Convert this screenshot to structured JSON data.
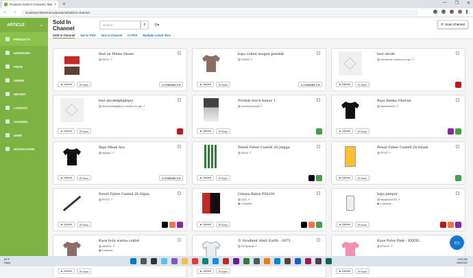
{
  "browser": {
    "tab_title": "Products Sold In Channel | Manu...",
    "url": "localhost:3001/menu/products/sold-in-channel"
  },
  "sidebar": {
    "brand": "ARTICLE",
    "items": [
      {
        "label": "PRODUCTS",
        "active": true
      },
      {
        "label": "INVENTORY"
      },
      {
        "label": "PRICE"
      },
      {
        "label": "ORDER"
      },
      {
        "label": "REPORT"
      },
      {
        "label": "LOGISTIC"
      },
      {
        "label": "CHANNEL"
      },
      {
        "label": "USER"
      },
      {
        "label": "NOTIFICATION"
      }
    ]
  },
  "header": {
    "title": "Sold In Channel",
    "search_placeholder": "Search",
    "search_button": "Q",
    "filter_icon": "filter-icon",
    "scan_channel": "Scan Channel"
  },
  "tabs": [
    "Sold in Channel",
    "Not in POS",
    "Not in Channel",
    "In POS",
    "Multiple Listed SKU"
  ],
  "card_labels": {
    "upload": "Upload",
    "scan": "Scan"
  },
  "cards": [
    {
      "name": "Red on White Shoes",
      "sku": "00010",
      "channels": "4 CHANNELS",
      "thumb": "shoes"
    },
    {
      "name": "baju coklat lengan pendek",
      "sku": "200300",
      "channels": "4 CHANNELS",
      "thumb": "brownshirt"
    },
    {
      "name": "test abcde",
      "sku": "test-abcde-creation-for-api",
      "marks": [
        "#b71c1c"
      ],
      "thumb": "placeholder"
    },
    {
      "name": "test abcdefghijklpoi",
      "sku": "test-abcdefghijkl-pi-creation-for-api",
      "marks": [
        "#b71c1c"
      ],
      "thumb": "placeholder"
    },
    {
      "name": "Produk stock minus 1",
      "sku": "minus1productd",
      "marks": [
        "#43a047"
      ],
      "thumb": "person"
    },
    {
      "name": "Baju Aneka Ukuran",
      "sku": "anekaukuran",
      "marks": [
        "#8e24aa",
        "#43a047"
      ],
      "thumb": "blackshirt"
    },
    {
      "name": "Baju Mbak Ayu",
      "sku": "bajuayu",
      "channels": "4 CHANNELS",
      "thumb": "blackshirt"
    },
    {
      "name": "Pensil Faber Castell 2b jingga",
      "sku": "00019",
      "marks": [
        "#000000",
        "#43a047"
      ],
      "thumb": "pencils"
    },
    {
      "name": "Pensil Faber Castell 2b hitam",
      "sku": "PF007",
      "marks": [
        "#43a047"
      ],
      "thumb": "pencilpack"
    },
    {
      "name": "Pensil Faber Castell 2b Hijau",
      "sku": "PF007",
      "marks": [
        "#000000",
        "#ff7043",
        "#8e24aa"
      ],
      "thumb": "pencil"
    },
    {
      "name": "Celana Balon POLOS",
      "sku": "2232",
      "variants": "2 variants",
      "marks": [
        "#000000",
        "#ff7043",
        "#43a047"
      ],
      "thumb": "pants"
    },
    {
      "name": "baju jempol",
      "sku": "bajujempol123",
      "variants": "2 variants",
      "marks": [
        "#b71c1c",
        "#ff7043",
        "#8e24aa"
      ],
      "thumb": "phone"
    },
    {
      "name": "Kaos bola warna coklat",
      "sku": "ABM001",
      "variants": "2 variants",
      "thumb": "brownshirt"
    },
    {
      "name": "© Gradient Shirt Earth - 2675",
      "sku": "2675pdeds",
      "thumb": "tshirt"
    },
    {
      "name": "Kaos Polos Pink - XXXXL",
      "sku": "KP0010",
      "thumb": "pinkshirt"
    }
  ],
  "taskbar": {
    "weather_temp": "82°F",
    "weather_text": "Hazy",
    "time": "9:53 AM",
    "date": "8/8/2022"
  }
}
